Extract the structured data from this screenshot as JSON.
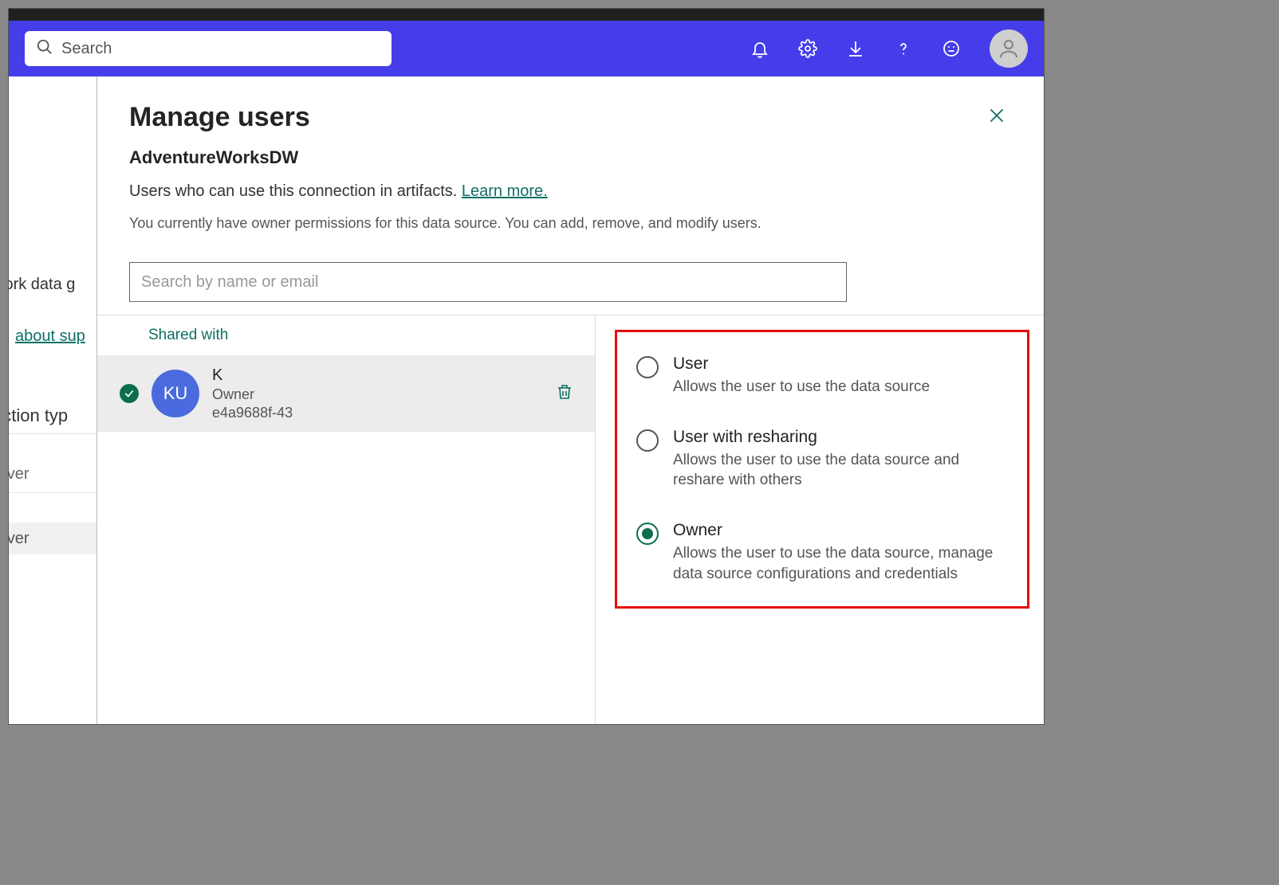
{
  "header": {
    "search_placeholder": "Search"
  },
  "background": {
    "text1": "work data g",
    "link": "about sup",
    "text2": "ection typ",
    "row1": "erver",
    "row2": "erver"
  },
  "panel": {
    "title": "Manage users",
    "subtitle": "AdventureWorksDW",
    "desc_prefix": "Users who can use this connection in artifacts. ",
    "learn_more": "Learn more.",
    "permission_hint": "You currently have owner permissions for this data source. You can add, remove, and modify users.",
    "user_search_placeholder": "Search by name or email",
    "shared_with_label": "Shared with"
  },
  "user": {
    "initials": "KU",
    "name": "K",
    "role": "Owner",
    "id": "e4a9688f-43"
  },
  "roles": [
    {
      "title": "User",
      "desc": "Allows the user to use the data source",
      "selected": false
    },
    {
      "title": "User with resharing",
      "desc": "Allows the user to use the data source and reshare with others",
      "selected": false
    },
    {
      "title": "Owner",
      "desc": "Allows the user to use the data source, manage data source configurations and credentials",
      "selected": true
    }
  ]
}
